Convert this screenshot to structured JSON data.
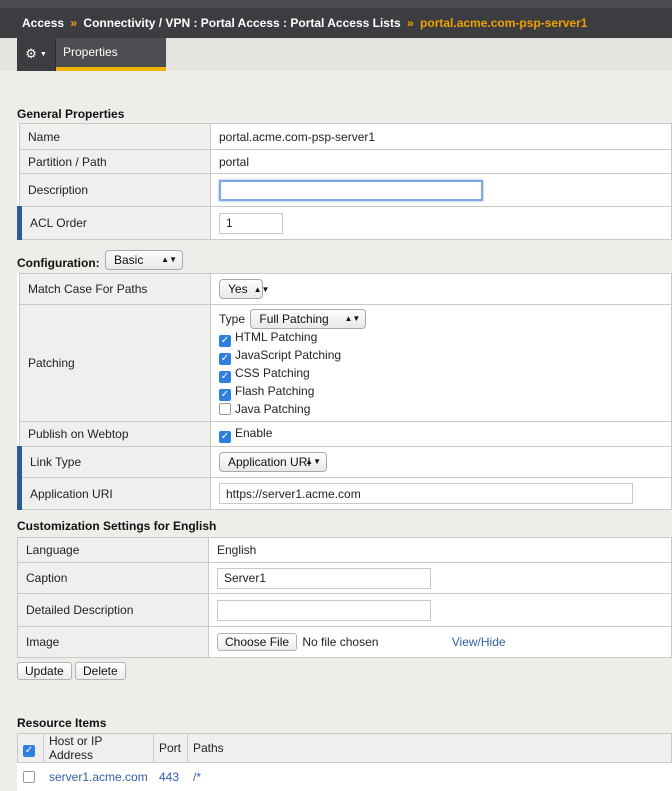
{
  "breadcrumb": {
    "items": [
      "Access",
      "Connectivity / VPN : Portal Access : Portal Access Lists"
    ],
    "separator": "»",
    "current": "portal.acme.com-psp-server1"
  },
  "tabs": {
    "properties": "Properties"
  },
  "general": {
    "title": "General Properties",
    "name_label": "Name",
    "name_value": "portal.acme.com-psp-server1",
    "partition_label": "Partition / Path",
    "partition_value": "portal",
    "description_label": "Description",
    "description_value": "",
    "acl_label": "ACL Order",
    "acl_value": "1"
  },
  "configuration": {
    "title": "Configuration:",
    "mode": "Basic",
    "match_case_label": "Match Case For Paths",
    "match_case_value": "Yes",
    "patching_label": "Patching",
    "type_label": "Type",
    "type_value": "Full Patching",
    "options": [
      {
        "label": "HTML Patching",
        "checked": true
      },
      {
        "label": "JavaScript Patching",
        "checked": true
      },
      {
        "label": "CSS Patching",
        "checked": true
      },
      {
        "label": "Flash Patching",
        "checked": true
      },
      {
        "label": "Java Patching",
        "checked": false
      }
    ],
    "publish_label": "Publish on Webtop",
    "publish_value": "Enable",
    "link_type_label": "Link Type",
    "link_type_value": "Application URI",
    "app_uri_label": "Application URI",
    "app_uri_value": "https://server1.acme.com"
  },
  "customization": {
    "title": "Customization Settings for English",
    "language_label": "Language",
    "language_value": "English",
    "caption_label": "Caption",
    "caption_value": "Server1",
    "detailed_label": "Detailed Description",
    "detailed_value": "",
    "image_label": "Image",
    "choose_file": "Choose File",
    "no_file": "No file chosen",
    "view_hide": "View/Hide"
  },
  "actions": {
    "update": "Update",
    "delete": "Delete"
  },
  "resources": {
    "title": "Resource Items",
    "columns": [
      "Host or IP Address",
      "Port",
      "Paths"
    ],
    "rows": [
      {
        "host": "server1.acme.com",
        "port": "443",
        "path": "/*"
      }
    ]
  }
}
